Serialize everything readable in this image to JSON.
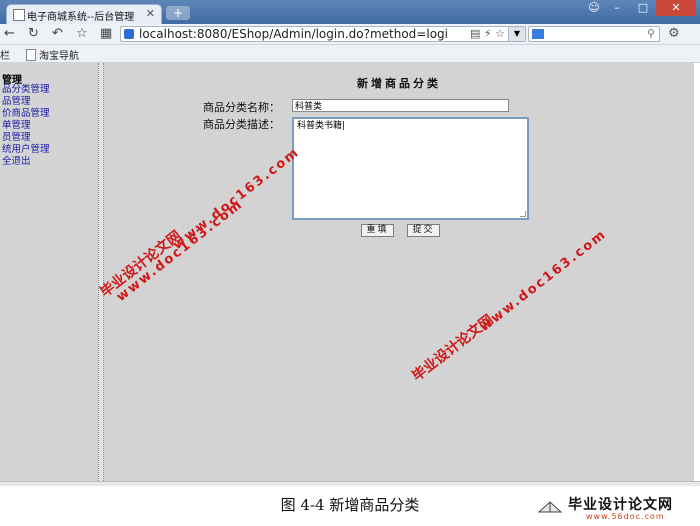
{
  "browser": {
    "tab_title": "电子商城系统--后台管理",
    "tab_close": "✕",
    "new_tab": "+",
    "url": "localhost:8080/EShop/Admin/login.do?method=logi",
    "bookmarks": [
      "栏",
      "淘宝导航"
    ]
  },
  "sidebar": {
    "title": "管理",
    "items": [
      "品分类管理",
      "品管理",
      "价商品管理",
      "单管理",
      "员管理",
      "统用户管理",
      "全退出"
    ]
  },
  "form": {
    "title": "新增商品分类",
    "name_label": "商品分类名称：",
    "name_value": "科普类",
    "desc_label": "商品分类描述：",
    "desc_value": "科普类书籍",
    "reset_label": "重填",
    "submit_label": "提交"
  },
  "caption": "图 4-4 新增商品分类",
  "watermark": {
    "line1": "毕业设计论文网",
    "line2": "www.doc163.com"
  },
  "logo": {
    "text": "毕业设计论文网",
    "url": "www.56doc.com"
  },
  "colors": {
    "watermark": "#d01818",
    "sidebar_link": "#1a1aa6",
    "titlebar": "#4a73aa"
  }
}
